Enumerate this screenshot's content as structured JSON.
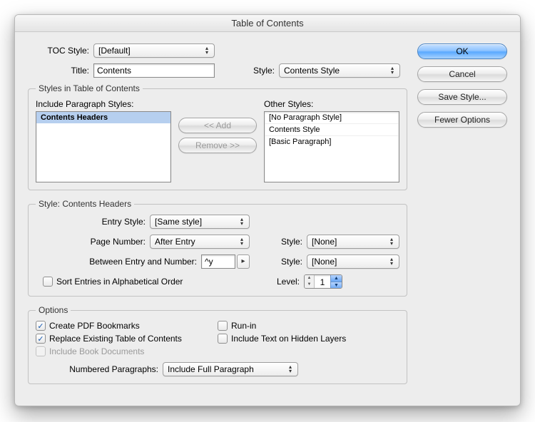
{
  "title": "Table of Contents",
  "top": {
    "toc_style_label": "TOC Style:",
    "toc_style_value": "[Default]",
    "title_label": "Title:",
    "title_value": "Contents",
    "style_label": "Style:",
    "style_value": "Contents Style"
  },
  "styles_group": {
    "legend": "Styles in Table of Contents",
    "include_label": "Include Paragraph Styles:",
    "include_item": "Contents Headers",
    "other_label": "Other Styles:",
    "other_items": [
      "[No Paragraph Style]",
      "Contents Style",
      "[Basic Paragraph]"
    ],
    "add_label": "<< Add",
    "remove_label": "Remove >>"
  },
  "style_detail": {
    "legend": "Style: Contents Headers",
    "entry_style_label": "Entry Style:",
    "entry_style_value": "[Same style]",
    "page_number_label": "Page Number:",
    "page_number_value": "After Entry",
    "pn_style_label": "Style:",
    "pn_style_value": "[None]",
    "between_label": "Between Entry and Number:",
    "between_value": "^y",
    "bt_style_label": "Style:",
    "bt_style_value": "[None]",
    "sort_label": "Sort Entries in Alphabetical Order",
    "level_label": "Level:",
    "level_value": "1"
  },
  "options": {
    "legend": "Options",
    "create_pdf": "Create PDF Bookmarks",
    "replace_toc": "Replace Existing Table of Contents",
    "include_book": "Include Book Documents",
    "run_in": "Run-in",
    "include_hidden": "Include Text on Hidden Layers",
    "numbered_label": "Numbered Paragraphs:",
    "numbered_value": "Include Full Paragraph"
  },
  "buttons": {
    "ok": "OK",
    "cancel": "Cancel",
    "save_style": "Save Style...",
    "fewer": "Fewer Options"
  }
}
